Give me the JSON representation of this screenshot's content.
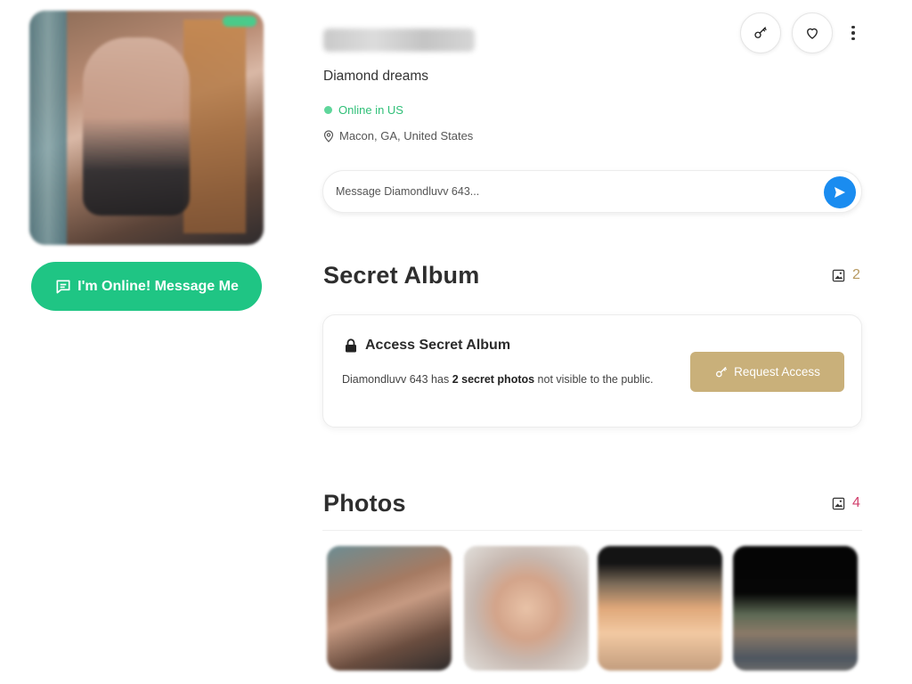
{
  "profile": {
    "tagline": "Diamond dreams",
    "status": "Online in US",
    "location": "Macon, GA, United States",
    "online_button_label": "I'm Online! Message Me"
  },
  "message": {
    "placeholder": "Message Diamondluvv 643..."
  },
  "secret_album": {
    "title": "Secret Album",
    "count": "2",
    "card_title": "Access Secret Album",
    "text_before": "Diamondluvv 643 has ",
    "text_bold": "2 secret photos",
    "text_after": " not visible to the public.",
    "request_button_label": "Request Access"
  },
  "photos": {
    "title": "Photos",
    "count": "4"
  },
  "colors": {
    "online_green": "#1fc584",
    "send_blue": "#1a8cf0",
    "gold": "#c9b07a",
    "photos_count_pink": "#d2426e"
  },
  "icons": {
    "message": "chat-bubble-icon",
    "key": "key-icon",
    "favorite": "heart-icon",
    "more": "more-vertical-icon",
    "location": "map-pin-icon",
    "send": "send-icon",
    "album": "image-icon",
    "lock": "lock-icon"
  }
}
